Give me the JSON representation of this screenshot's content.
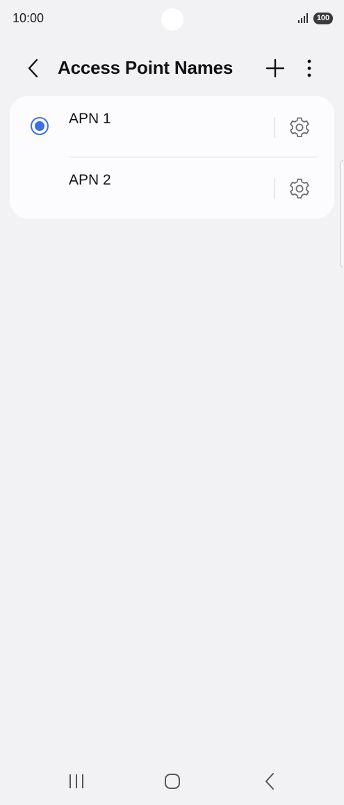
{
  "status_bar": {
    "time": "10:00",
    "battery": "100",
    "icons": [
      "signal-icon",
      "battery-icon"
    ]
  },
  "app_bar": {
    "title": "Access Point Names",
    "icons": [
      "back-arrow-icon",
      "plus-icon",
      "more-vertical-icon"
    ]
  },
  "apn_list": [
    {
      "label": "APN 1",
      "selected": true,
      "icon": "gear-icon"
    },
    {
      "label": "APN 2",
      "selected": false,
      "icon": "gear-icon"
    }
  ],
  "nav_bar": {
    "icons": [
      "recents-icon",
      "home-icon",
      "back-icon"
    ]
  },
  "colors": {
    "accent": "#3c6fe6",
    "background": "#f2f2f4",
    "card": "#fcfcfe"
  }
}
